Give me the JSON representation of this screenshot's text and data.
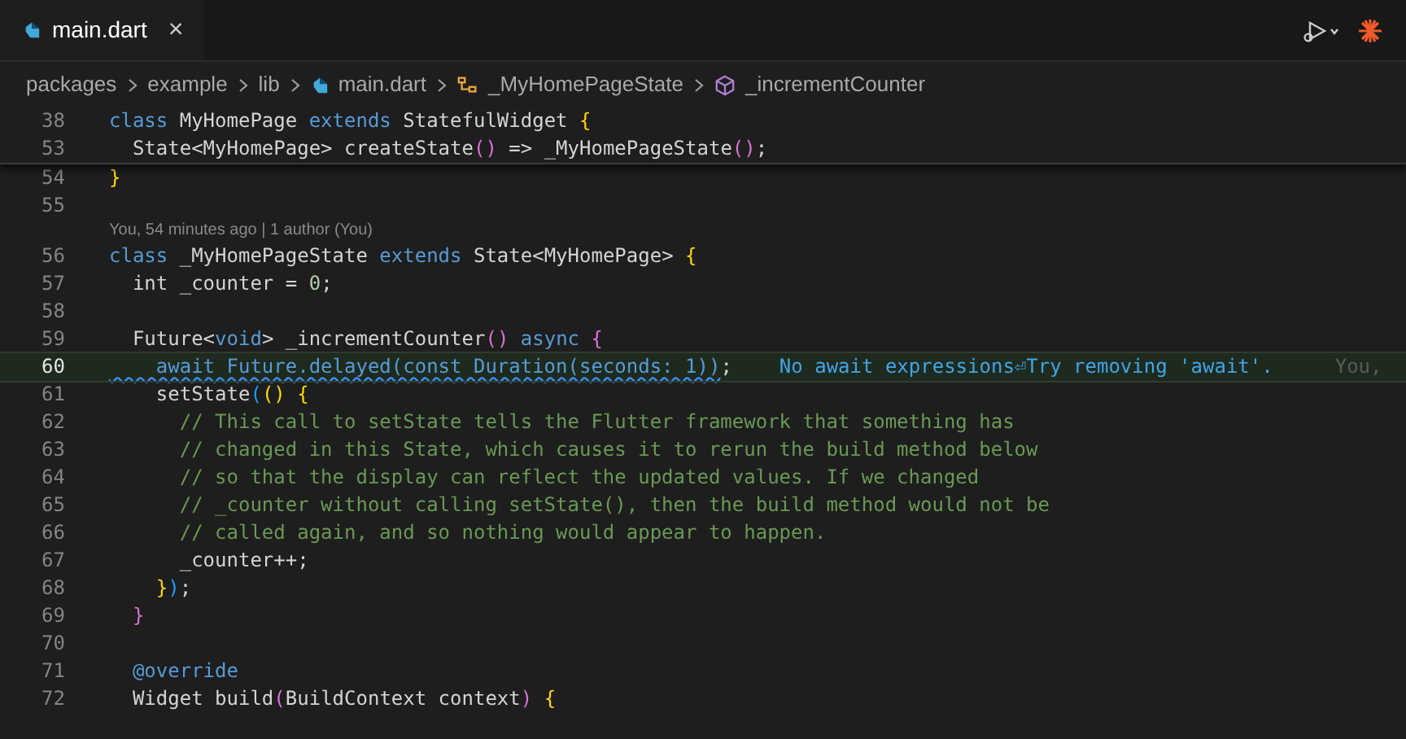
{
  "tab": {
    "label": "main.dart",
    "selected": true,
    "close": "×"
  },
  "breadcrumb": [
    {
      "kind": "folder",
      "label": "packages"
    },
    {
      "kind": "folder",
      "label": "example"
    },
    {
      "kind": "folder",
      "label": "lib"
    },
    {
      "kind": "file",
      "label": "main.dart"
    },
    {
      "kind": "class",
      "label": "_MyHomePageState"
    },
    {
      "kind": "method",
      "label": "_incrementCounter"
    }
  ],
  "sticky_lines": [
    {
      "number": "38",
      "tokens": [
        {
          "kind": "kw",
          "text": "class"
        },
        {
          "kind": "plain",
          "text": " MyHomePage "
        },
        {
          "kind": "kw",
          "text": "extends"
        },
        {
          "kind": "plain",
          "text": " StatefulWidget "
        },
        {
          "kind": "b1",
          "text": "{"
        }
      ]
    },
    {
      "number": "53",
      "tokens": [
        {
          "kind": "plain",
          "text": "  State<MyHomePage> createState"
        },
        {
          "kind": "b2",
          "text": "()"
        },
        {
          "kind": "plain",
          "text": " => _MyHomePageState"
        },
        {
          "kind": "b2",
          "text": "()"
        },
        {
          "kind": "plain",
          "text": ";"
        }
      ]
    }
  ],
  "lines": [
    {
      "kind": "code",
      "number": "54",
      "current": false,
      "tokens": [
        {
          "kind": "b1",
          "text": "}"
        }
      ]
    },
    {
      "kind": "code",
      "number": "55",
      "current": false
    },
    {
      "kind": "codelens",
      "text": "You, 54 minutes ago | 1 author (You)"
    },
    {
      "kind": "code",
      "number": "56",
      "current": false,
      "tokens": [
        {
          "kind": "kw",
          "text": "class"
        },
        {
          "kind": "plain",
          "text": " _MyHomePageState "
        },
        {
          "kind": "kw",
          "text": "extends"
        },
        {
          "kind": "plain",
          "text": " State<MyHomePage> "
        },
        {
          "kind": "b1",
          "text": "{"
        }
      ]
    },
    {
      "kind": "code",
      "number": "57",
      "current": false,
      "tokens": [
        {
          "kind": "plain",
          "text": "  int _counter = "
        },
        {
          "kind": "num",
          "text": "0"
        },
        {
          "kind": "plain",
          "text": ";"
        }
      ]
    },
    {
      "kind": "code",
      "number": "58",
      "current": false
    },
    {
      "kind": "code",
      "number": "59",
      "current": false,
      "tokens": [
        {
          "kind": "plain",
          "text": "  Future<"
        },
        {
          "kind": "kw",
          "text": "void"
        },
        {
          "kind": "plain",
          "text": "> _incrementCounter"
        },
        {
          "kind": "b2",
          "text": "()"
        },
        {
          "kind": "kw",
          "text": " async"
        },
        {
          "kind": "b2",
          "text": " {"
        }
      ]
    },
    {
      "kind": "code",
      "number": "60",
      "current": true,
      "squiggle": true,
      "tokens": [
        {
          "kind": "kw",
          "text": "    await Future.delayed(const Duration(seconds: 1))"
        },
        {
          "kind": "plain",
          "text": ";"
        }
      ],
      "hint": "No await expressions⏎Try removing 'await'.",
      "blame": "You,"
    },
    {
      "kind": "code",
      "number": "61",
      "current": false,
      "tokens": [
        {
          "kind": "plain",
          "text": "    setState"
        },
        {
          "kind": "b3",
          "text": "("
        },
        {
          "kind": "b1",
          "text": "()"
        },
        {
          "kind": "b1",
          "text": " {"
        }
      ]
    },
    {
      "kind": "code",
      "number": "62",
      "current": false,
      "tokens": [
        {
          "kind": "comment",
          "text": "      // This call to setState tells the Flutter framework that something has"
        }
      ]
    },
    {
      "kind": "code",
      "number": "63",
      "current": false,
      "tokens": [
        {
          "kind": "comment",
          "text": "      // changed in this State, which causes it to rerun the build method below"
        }
      ]
    },
    {
      "kind": "code",
      "number": "64",
      "current": false,
      "tokens": [
        {
          "kind": "comment",
          "text": "      // so that the display can reflect the updated values. If we changed"
        }
      ]
    },
    {
      "kind": "code",
      "number": "65",
      "current": false,
      "tokens": [
        {
          "kind": "comment",
          "text": "      // _counter without calling setState(), then the build method would not be"
        }
      ]
    },
    {
      "kind": "code",
      "number": "66",
      "current": false,
      "tokens": [
        {
          "kind": "comment",
          "text": "      // called again, and so nothing would appear to happen."
        }
      ]
    },
    {
      "kind": "code",
      "number": "67",
      "current": false,
      "tokens": [
        {
          "kind": "plain",
          "text": "      _counter++;"
        }
      ]
    },
    {
      "kind": "code",
      "number": "68",
      "current": false,
      "tokens": [
        {
          "kind": "b1",
          "text": "    }"
        },
        {
          "kind": "b3",
          "text": ")"
        },
        {
          "kind": "plain",
          "text": ";"
        }
      ]
    },
    {
      "kind": "code",
      "number": "69",
      "current": false,
      "tokens": [
        {
          "kind": "b2",
          "text": "  }"
        }
      ]
    },
    {
      "kind": "code",
      "number": "70",
      "current": false
    },
    {
      "kind": "code",
      "number": "71",
      "current": false,
      "tokens": [
        {
          "kind": "kw",
          "text": "  @override"
        }
      ]
    },
    {
      "kind": "code",
      "number": "72",
      "current": false,
      "tokens": [
        {
          "kind": "plain",
          "text": "  Widget build"
        },
        {
          "kind": "b2",
          "text": "("
        },
        {
          "kind": "plain",
          "text": "BuildContext context"
        },
        {
          "kind": "b2",
          "text": ")"
        },
        {
          "kind": "b1",
          "text": " {"
        }
      ]
    }
  ]
}
